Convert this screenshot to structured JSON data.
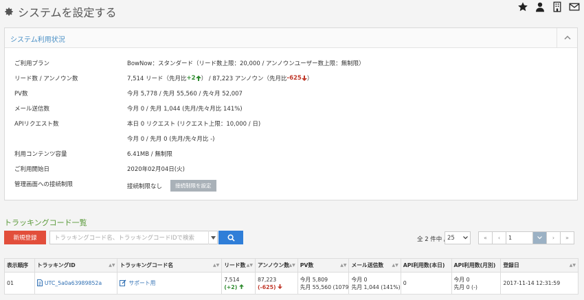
{
  "header": {
    "title": "システムを設定する"
  },
  "top_icons": [
    "star-icon",
    "user-icon",
    "building-icon",
    "mail-icon"
  ],
  "panel": {
    "title": "システム利用状況",
    "rows": [
      {
        "label": "ご利用プラン",
        "value": "BowNow：スタンダード（リード数上限：20,000  /  アンノウンユーザー数上限：無制限）"
      },
      {
        "label": "リード数 / アンノウン数",
        "v1": "7,514 リード（先月比 ",
        "v1g": "+2",
        "v2": "）  /  87,223 アンノウン（先月比 ",
        "v2r": "-625",
        "v3": "）"
      },
      {
        "label": "PV数",
        "value": "今月 5,778  /  先月 55,560  /  先々月 52,007"
      },
      {
        "label": "メール送信数",
        "value": "今月 0  /  先月 1,044  (先月/先々月比 141%)"
      },
      {
        "label": "APIリクエスト数",
        "value": "本日 0 リクエスト (リクエスト上限：10,000  /  日)"
      },
      {
        "label": "",
        "value": "今月 0  /  先月 0  (先月/先々月比 -)"
      },
      {
        "label": "利用コンテンツ容量",
        "value": "6.41MB  /  無制限"
      },
      {
        "label": "ご利用開始日",
        "value": "2020年02月04日(火)"
      },
      {
        "label": "管理画面への接続制限",
        "value": "接続制限なし",
        "button": "接続制限を設定"
      }
    ]
  },
  "tracking": {
    "title": "トラッキングコード一覧",
    "new_button": "新規登録",
    "search_placeholder": "トラッキングコード名、トラッキングコードIDで検索",
    "count_text": "全 2 件中 /",
    "per_page": "25",
    "page_input": "1",
    "pager": {
      "first": "«",
      "prev": "‹",
      "next": "›",
      "last": "»"
    },
    "columns": [
      "表示順序",
      "トラッキングID",
      "トラッキングコード名",
      "リード数",
      "アンノウン数",
      "PV数",
      "メール送信数",
      "API利用数(本日)",
      "API利用数(月別)",
      "登録日"
    ],
    "rows": [
      {
        "order": "01",
        "id": "UTC_5a0a63989852a",
        "name": "サポート用",
        "lead": "7,514",
        "lead_diff": "(+2)",
        "unknown": "87,223",
        "unknown_diff": "(-625)",
        "pv1": "今月 5,809",
        "pv2": "先月 55,560 (1079",
        "mail1": "今月 0",
        "mail2": "先月 1,044 (141%)",
        "api_today": "0",
        "api_m1": "今月 0",
        "api_m2": "先月 0 (-)",
        "date": "2017-11-14 12:31:59"
      }
    ]
  }
}
